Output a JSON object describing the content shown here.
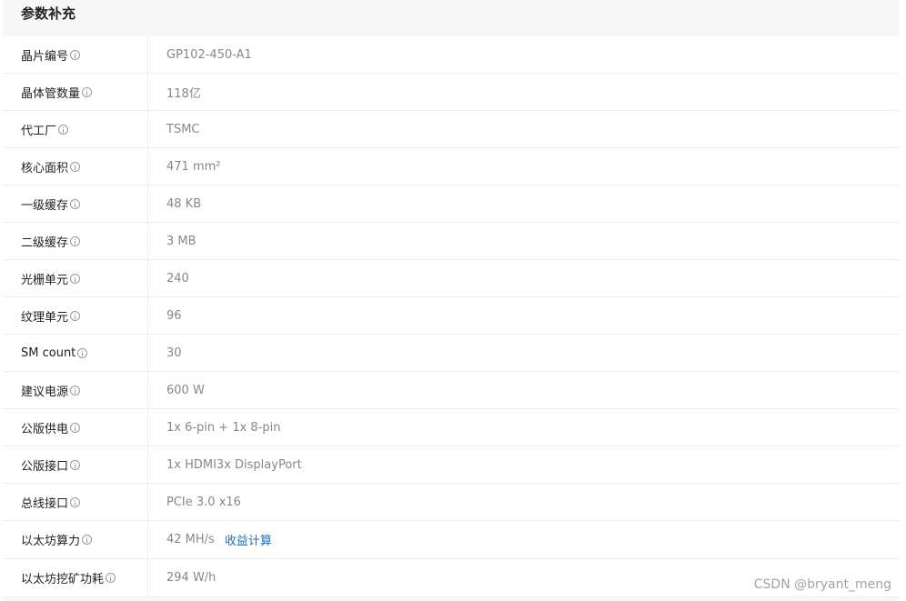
{
  "section_title": "参数补充",
  "rows": [
    {
      "label": "晶片编号",
      "value": "GP102-450-A1"
    },
    {
      "label": "晶体管数量",
      "value": "118亿"
    },
    {
      "label": "代工厂",
      "value": "TSMC"
    },
    {
      "label": "核心面积",
      "value": "471 mm²"
    },
    {
      "label": "一级缓存",
      "value": "48 KB"
    },
    {
      "label": "二级缓存",
      "value": "3 MB"
    },
    {
      "label": "光栅单元",
      "value": "240"
    },
    {
      "label": "纹理单元",
      "value": "96"
    },
    {
      "label": "SM count",
      "value": "30"
    },
    {
      "label": "建议电源",
      "value": "600 W"
    },
    {
      "label": "公版供电",
      "value": "1x 6-pin + 1x 8-pin"
    },
    {
      "label": "公版接口",
      "value": "1x HDMI3x DisplayPort"
    },
    {
      "label": "总线接口",
      "value": "PCIe 3.0 x16"
    },
    {
      "label": "以太坊算力",
      "value": "42 MH/s",
      "link": "收益计算"
    },
    {
      "label": "以太坊挖矿功耗",
      "value": "294 W/h"
    }
  ],
  "watermark": "CSDN @bryant_meng",
  "colors": {
    "link": "#1a73c8",
    "label": "#222222",
    "value": "#888888"
  }
}
